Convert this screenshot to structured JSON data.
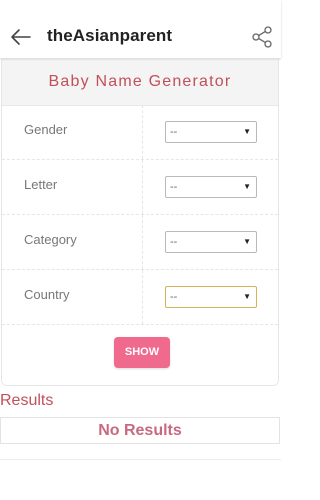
{
  "appbar": {
    "title": "theAsianparent",
    "back_icon": "arrow-left-icon",
    "share_icon": "share-icon"
  },
  "generator": {
    "title": "Baby Name Generator",
    "fields": [
      {
        "label": "Gender",
        "value": "--"
      },
      {
        "label": "Letter",
        "value": "--"
      },
      {
        "label": "Category",
        "value": "--"
      },
      {
        "label": "Country",
        "value": "--"
      }
    ],
    "dropdown_arrow": "▼",
    "submit_label": "SHOW"
  },
  "results": {
    "heading": "Results",
    "empty_message": "No Results"
  },
  "colors": {
    "accent": "#c0505a",
    "button": "#f06a8d",
    "focus_border": "#d4b25a"
  }
}
